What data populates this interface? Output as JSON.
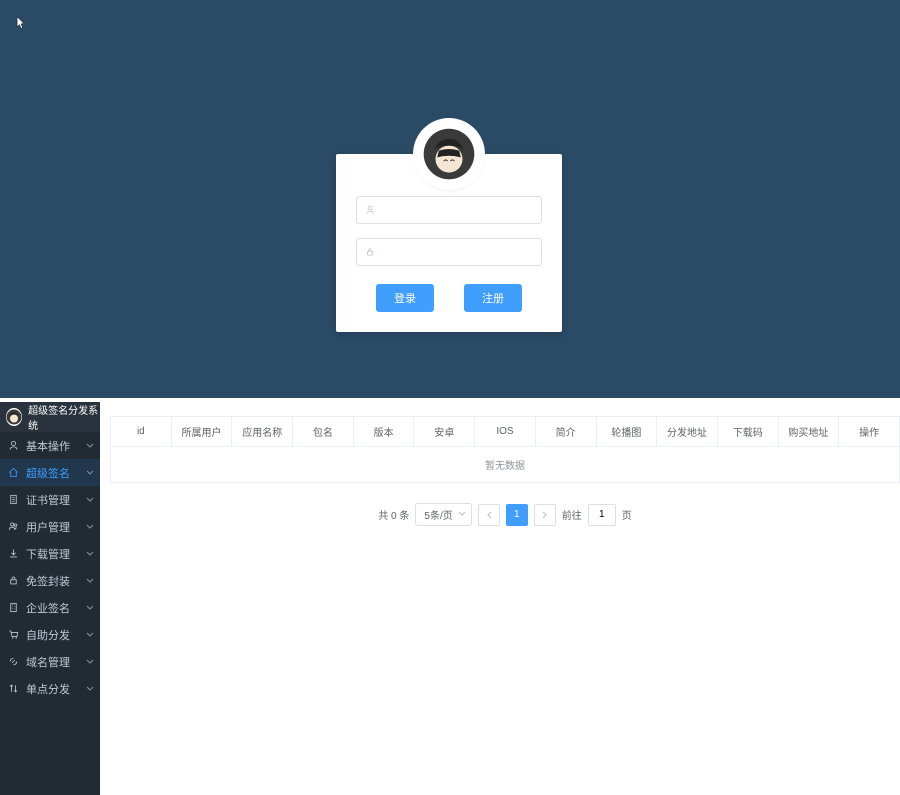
{
  "login": {
    "username_value": "",
    "password_value": "",
    "login_btn": "登录",
    "register_btn": "注册"
  },
  "brand_title": "超级签名分发系统",
  "sidebar": [
    {
      "label": "基本操作",
      "icon": "user"
    },
    {
      "label": "超级签名",
      "icon": "home",
      "active": true
    },
    {
      "label": "证书管理",
      "icon": "file"
    },
    {
      "label": "用户管理",
      "icon": "users"
    },
    {
      "label": "下载管理",
      "icon": "download"
    },
    {
      "label": "免签封装",
      "icon": "lock"
    },
    {
      "label": "企业签名",
      "icon": "building"
    },
    {
      "label": "自助分发",
      "icon": "cart"
    },
    {
      "label": "域名管理",
      "icon": "link"
    },
    {
      "label": "单点分发",
      "icon": "sort"
    }
  ],
  "columns": [
    "id",
    "所属用户",
    "应用名称",
    "包名",
    "版本",
    "安卓",
    "IOS",
    "简介",
    "轮播图",
    "分发地址",
    "下载码",
    "购买地址",
    "操作"
  ],
  "empty_text": "暂无数据",
  "pagination": {
    "total_text": "共 0 条",
    "page_size": "5条/页",
    "current": "1",
    "jump_prefix": "前往",
    "jump_value": "1",
    "jump_suffix": "页"
  }
}
